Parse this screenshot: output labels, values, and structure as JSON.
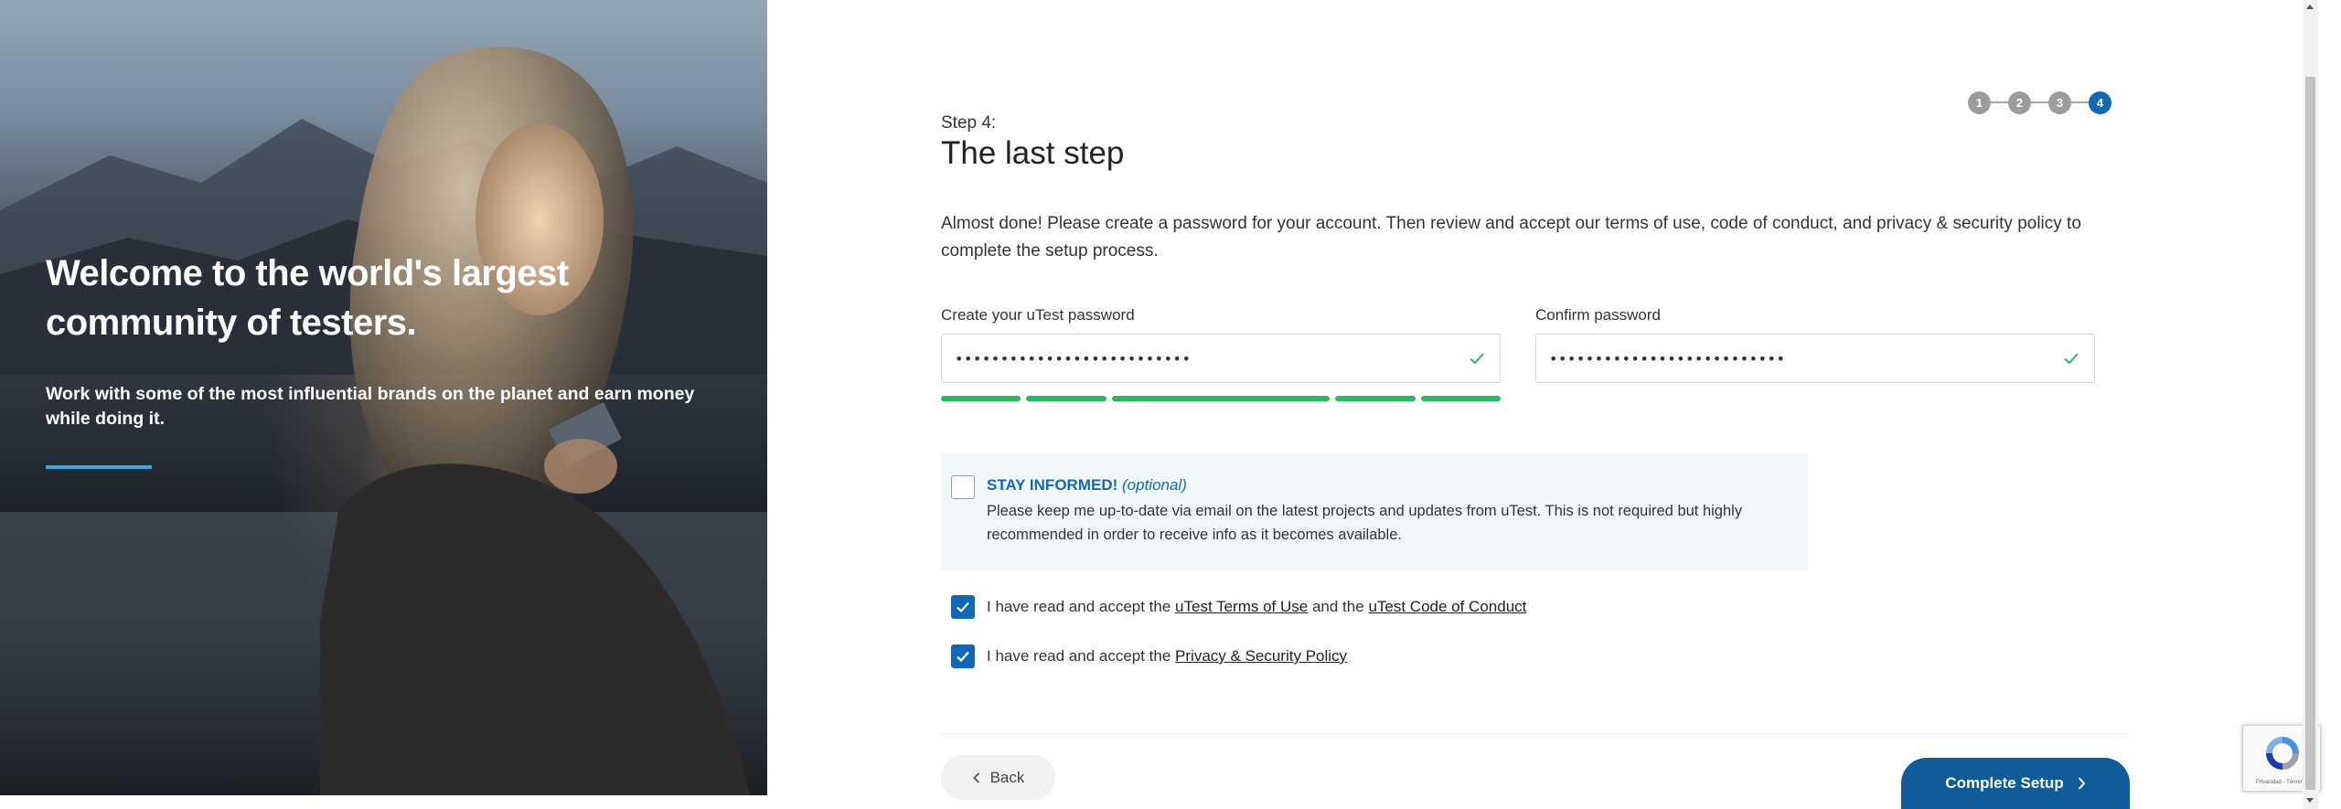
{
  "hero": {
    "title": "Welcome to the world's largest community of testers.",
    "subtitle": "Work with some of the most influential brands on the planet and earn money while doing it.",
    "accent_color": "#3aa6dd"
  },
  "stepper": {
    "steps": [
      "1",
      "2",
      "3",
      "4"
    ],
    "active_step": "4",
    "active_color": "#1169b6"
  },
  "header": {
    "step_label": "Step 4:",
    "title": "The last step"
  },
  "intro_text": "Almost done! Please create a password for your account. Then review and accept our terms of use, code of conduct, and privacy & security policy to complete the setup process.",
  "password": {
    "label": "Create your uTest password",
    "value": "••••••••••••••••••••••••••",
    "valid_icon": "check-icon"
  },
  "confirm_password": {
    "label": "Confirm password",
    "value": "••••••••••••••••••••••••••",
    "valid_icon": "check-icon"
  },
  "strength_color": "#27b863",
  "optin": {
    "title": "STAY INFORMED!",
    "optional": "(optional)",
    "text": "Please keep me up-to-date via email on the latest projects and updates from uTest. This is not required but highly recommended in order to receive info as it becomes available.",
    "checked": false
  },
  "terms": {
    "prefix": "I have read and accept the",
    "terms_link": "uTest Terms of Use",
    "middle": "and the",
    "conduct_link": "uTest Code of Conduct",
    "checked": true
  },
  "privacy": {
    "prefix": "I have read and accept the",
    "privacy_link": "Privacy & Security Policy",
    "checked": true
  },
  "buttons": {
    "back": "Back",
    "complete": "Complete Setup"
  },
  "recaptcha": {
    "text": "Privacidad - Términos"
  }
}
